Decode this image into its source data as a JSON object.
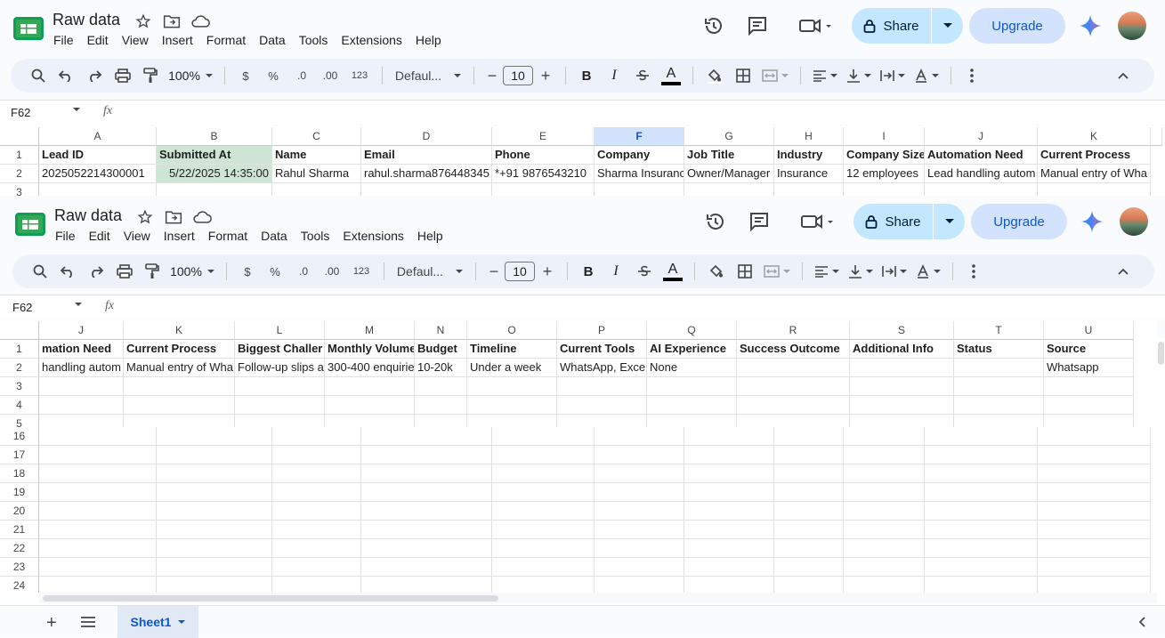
{
  "doc": {
    "title": "Raw data"
  },
  "menu": [
    "File",
    "Edit",
    "View",
    "Insert",
    "Format",
    "Data",
    "Tools",
    "Extensions",
    "Help"
  ],
  "actions": {
    "share": "Share",
    "upgrade": "Upgrade"
  },
  "toolbar": {
    "zoom": "100%",
    "currency": "$",
    "percent": "%",
    "dec_minus": ".0",
    "dec_plus": ".00",
    "numfmt": "123",
    "font": "Defaul...",
    "font_size": "10",
    "bold": "B",
    "italic": "I",
    "text_color": "A"
  },
  "formula": {
    "namebox": "F62",
    "fx": "fx"
  },
  "colors": {
    "share_bg": "#c2e7ff",
    "upgrade_bg": "#d3e3fd",
    "selected_col": "#d3e3fd",
    "selected_cell": "#cee5d5",
    "accent": "#0b57d0"
  },
  "top_grid": {
    "columns": [
      "A",
      "B",
      "C",
      "D",
      "E",
      "F",
      "G",
      "H",
      "I",
      "J",
      "K"
    ],
    "row1": [
      "Lead ID",
      "Submitted At",
      "Name",
      "Email",
      "Phone",
      "Company",
      "Job Title",
      "Industry",
      "Company Size",
      "Automation Need",
      "Current Process"
    ],
    "row2": [
      "2025052214300001",
      "5/22/2025 14:35:00",
      "Rahul Sharma",
      "rahul.sharma876448345",
      "*+91 9876543210",
      "Sharma Insuranc",
      "Owner/Manager",
      "Insurance",
      "12 employees",
      "Lead handling autom",
      "Manual entry of Wha"
    ],
    "row_numbers": [
      "1",
      "2",
      "3"
    ]
  },
  "second_grid": {
    "columns": [
      "J",
      "K",
      "L",
      "M",
      "N",
      "O",
      "P",
      "Q",
      "R",
      "S",
      "T",
      "U"
    ],
    "row1": [
      "mation Need",
      "Current Process",
      "Biggest Challer",
      "Monthly Volume",
      "Budget",
      "Timeline",
      "Current Tools",
      "AI Experience",
      "Success Outcome",
      "Additional Info",
      "Status",
      "Source"
    ],
    "row2": [
      " handling autom",
      "Manual entry of Wha",
      "Follow-up slips a",
      "300-400 enquirie",
      "10-20k",
      "Under a week",
      "WhatsApp, Exce",
      "None",
      "",
      "",
      "",
      "Whatsapp"
    ],
    "row_numbers": [
      "1",
      "2",
      "3",
      "4",
      "5"
    ]
  },
  "lower_rows": [
    "16",
    "17",
    "18",
    "19",
    "20",
    "21",
    "22",
    "23",
    "24"
  ],
  "sheet": {
    "tab_name": "Sheet1"
  }
}
